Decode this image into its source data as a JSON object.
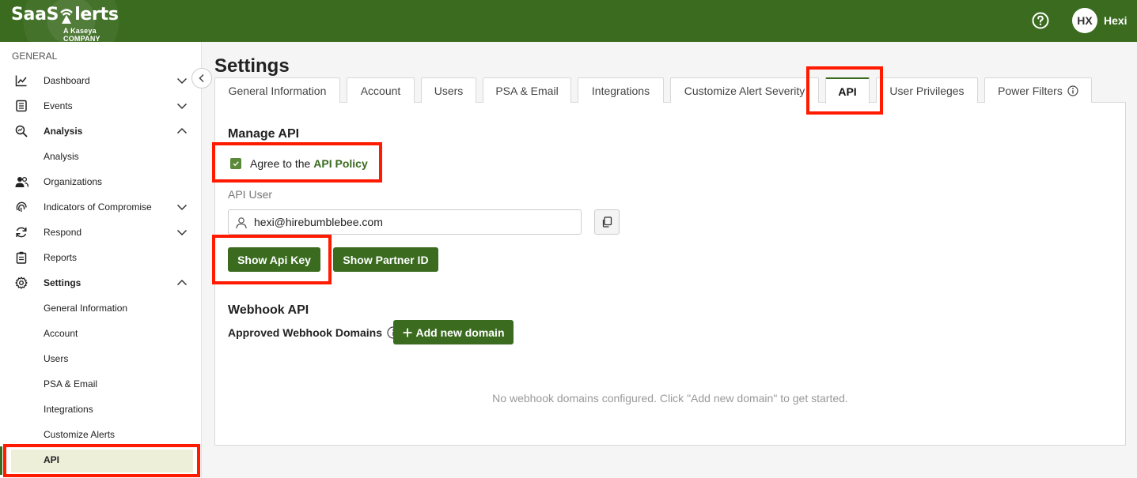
{
  "brand": {
    "name_part1": "Saa",
    "name_part2": "S",
    "name_part3": "lerts",
    "sub": "A Kaseya COMPANY"
  },
  "header": {
    "avatar_initials": "HX",
    "username": "Hexi"
  },
  "sidebar": {
    "section": "GENERAL",
    "items": [
      {
        "label": "Dashboard",
        "icon": "chart-line-icon",
        "chevron": "down"
      },
      {
        "label": "Events",
        "icon": "list-icon",
        "chevron": "down"
      },
      {
        "label": "Analysis",
        "icon": "magnifier-chart-icon",
        "chevron": "up",
        "bold": true
      },
      {
        "label": "Analysis",
        "sub": true
      },
      {
        "label": "Organizations",
        "icon": "users-icon"
      },
      {
        "label": "Indicators of Compromise",
        "icon": "fingerprint-icon",
        "chevron": "down"
      },
      {
        "label": "Respond",
        "icon": "refresh-icon",
        "chevron": "down"
      },
      {
        "label": "Reports",
        "icon": "clipboard-icon"
      },
      {
        "label": "Settings",
        "icon": "gear-icon",
        "chevron": "up",
        "bold": true
      },
      {
        "label": "General Information",
        "sub": true
      },
      {
        "label": "Account",
        "sub": true
      },
      {
        "label": "Users",
        "sub": true
      },
      {
        "label": "PSA & Email",
        "sub": true
      },
      {
        "label": "Integrations",
        "sub": true
      },
      {
        "label": "Customize Alerts",
        "sub": true
      },
      {
        "label": "API",
        "sub": true,
        "active": true
      }
    ]
  },
  "page": {
    "title": "Settings"
  },
  "tabs": [
    {
      "label": "General Information"
    },
    {
      "label": "Account"
    },
    {
      "label": "Users"
    },
    {
      "label": "PSA & Email"
    },
    {
      "label": "Integrations"
    },
    {
      "label": "Customize Alert Severity"
    },
    {
      "label": "API",
      "active": true
    },
    {
      "label": "User Privileges"
    },
    {
      "label": "Power Filters",
      "info": true
    }
  ],
  "manage_api": {
    "heading": "Manage API",
    "agree_text": "Agree to the",
    "policy_link": "API Policy",
    "agreed": true,
    "api_user_label": "API User",
    "api_user_value": "hexi@hirebumblebee.com",
    "show_key_label": "Show Api Key",
    "show_partner_label": "Show Partner ID"
  },
  "webhook": {
    "heading": "Webhook API",
    "domains_label": "Approved Webhook Domains",
    "add_label": "Add new domain",
    "empty_message": "No webhook domains configured. Click \"Add new domain\" to get started."
  },
  "colors": {
    "brand_green": "#3a6b1f",
    "highlight_red": "#ff1a00",
    "active_bg": "#eeefd9"
  }
}
